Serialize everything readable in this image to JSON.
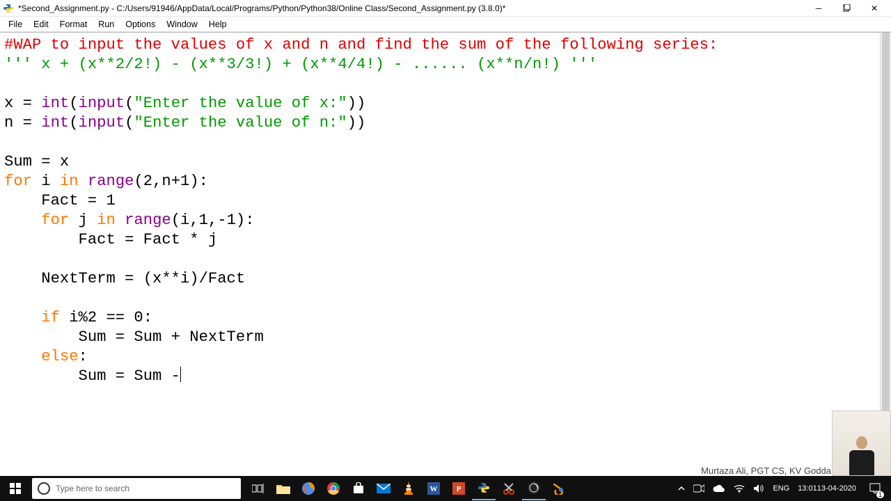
{
  "titlebar": {
    "title": "*Second_Assignment.py - C:/Users/91946/AppData/Local/Programs/Python/Python38/Online Class/Second_Assignment.py (3.8.0)*"
  },
  "menubar": {
    "items": [
      "File",
      "Edit",
      "Format",
      "Run",
      "Options",
      "Window",
      "Help"
    ]
  },
  "code": {
    "l1": "#WAP to input the values of x and n and find the sum of the following series:",
    "l2a": "''' x + (x**2/2!) - (x**3/3!) + (x**4/4!) - ...... (x**n/n!) '''",
    "l3": "",
    "l4a": "x = ",
    "l4b": "int",
    "l4c": "(",
    "l4d": "input",
    "l4e": "(",
    "l4f": "\"Enter the value of x:\"",
    "l4g": "))",
    "l5a": "n = ",
    "l5b": "int",
    "l5c": "(",
    "l5d": "input",
    "l5e": "(",
    "l5f": "\"Enter the value of n:\"",
    "l5g": "))",
    "l6": "",
    "l7": "Sum = x",
    "l8a": "for",
    "l8b": " i ",
    "l8c": "in",
    "l8d": " ",
    "l8e": "range",
    "l8f": "(2,n+1):",
    "l9": "    Fact = 1",
    "l10a": "    ",
    "l10b": "for",
    "l10c": " j ",
    "l10d": "in",
    "l10e": " ",
    "l10f": "range",
    "l10g": "(i,1,-1):",
    "l11": "        Fact = Fact * j",
    "l12": "",
    "l13": "    NextTerm = (x**i)/Fact",
    "l14": "",
    "l15a": "    ",
    "l15b": "if",
    "l15c": " i%2 == 0:",
    "l16": "        Sum = Sum + NextTerm",
    "l17a": "    ",
    "l17b": "else",
    "l17c": ":",
    "l18": "        Sum = Sum -"
  },
  "credit": "Murtaza Ali, PGT CS, KV Godda",
  "taskbar": {
    "search_placeholder": "Type here to search",
    "tray": {
      "lang": "ENG",
      "time": "13:01",
      "date": "13-04-2020",
      "notif_count": "1"
    },
    "icons": [
      "task-view-icon",
      "file-explorer-icon",
      "firefox-icon",
      "chrome-icon",
      "store-icon",
      "mail-icon",
      "vlc-icon",
      "word-icon",
      "powerpoint-icon",
      "idle-icon",
      "snip-icon",
      "obs-icon",
      "blender-icon"
    ]
  }
}
